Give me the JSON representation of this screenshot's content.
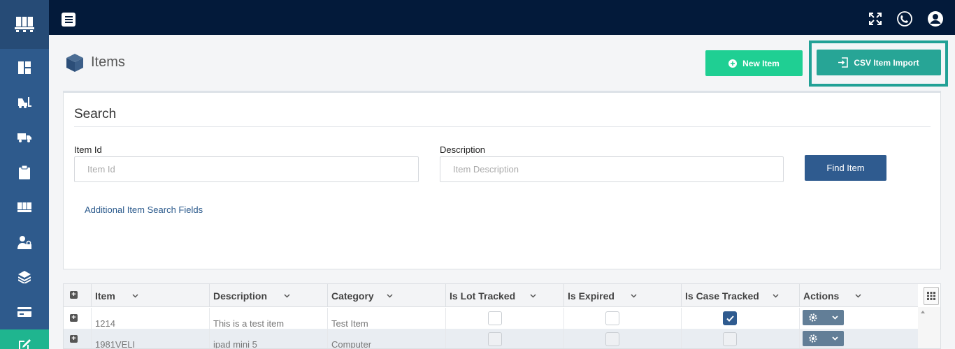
{
  "nav": {
    "items": [
      {
        "icon": "dashboard-icon"
      },
      {
        "icon": "forklift-icon"
      },
      {
        "icon": "truck-icon"
      },
      {
        "icon": "clipboard-icon"
      },
      {
        "icon": "dock-icon"
      },
      {
        "icon": "user-lock-icon"
      },
      {
        "icon": "layers-icon"
      },
      {
        "icon": "billing-card-icon"
      },
      {
        "icon": "edit-icon",
        "active": true
      }
    ]
  },
  "header": {
    "title": "Items",
    "new_item_label": "New Item",
    "csv_import_label": "CSV Item Import"
  },
  "search": {
    "title": "Search",
    "item_id_label": "Item Id",
    "item_id_placeholder": "Item Id",
    "item_id_value": "",
    "description_label": "Description",
    "description_placeholder": "Item Description",
    "description_value": "",
    "find_button": "Find Item",
    "advanced_link": "Additional Item Search Fields"
  },
  "grid": {
    "columns": [
      "Item",
      "Description",
      "Category",
      "Is Lot Tracked",
      "Is Expired",
      "Is Case Tracked",
      "Actions"
    ],
    "rows": [
      {
        "item": "1214",
        "description": "This is a test item",
        "category": "Test Item",
        "lot_tracked": false,
        "expired": false,
        "case_tracked": true
      },
      {
        "item": "1981VELI",
        "description": "ipad mini 5",
        "category": "Computer",
        "lot_tracked": false,
        "expired": false,
        "case_tracked": false
      }
    ]
  },
  "colors": {
    "sidebar": "#2e5a8c",
    "topbar": "#031a3a",
    "new_button": "#1fcf93",
    "csv_button": "#27a596",
    "find_button": "#2f5b8f",
    "active_nav": "#1fb58f"
  }
}
